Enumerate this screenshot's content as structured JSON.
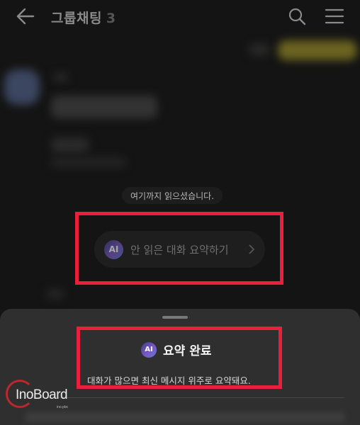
{
  "header": {
    "title": "그룹채팅",
    "member_count": "3"
  },
  "chat": {
    "read_divider_text": "여기까지 읽으셨습니다."
  },
  "summary_button": {
    "ai_label": "AI",
    "label": "안 읽은 대화 요약하기"
  },
  "sheet": {
    "ai_label": "AI",
    "title": "요약 완료",
    "description": "대화가 많으면 최신 메시지 위주로 요약돼요."
  },
  "watermark": {
    "text": "InoBoard",
    "sub": "ino.pbc"
  },
  "colors": {
    "highlight": "#e81f3d",
    "sheet_background": "#2f2f2f",
    "page_background": "#141414"
  }
}
